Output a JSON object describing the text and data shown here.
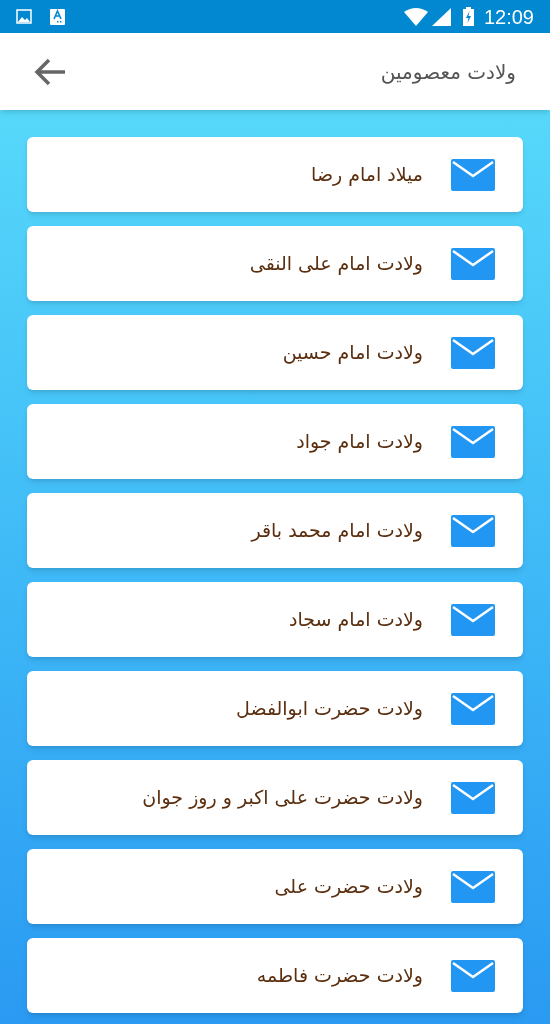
{
  "status_bar": {
    "time": "12:09"
  },
  "header": {
    "title": "ولادت معصومین"
  },
  "items": [
    {
      "label": "میلاد امام رضا"
    },
    {
      "label": "ولادت امام علی النقی"
    },
    {
      "label": "ولادت امام حسین"
    },
    {
      "label": "ولادت امام جواد"
    },
    {
      "label": "ولادت امام محمد باقر"
    },
    {
      "label": "ولادت امام سجاد"
    },
    {
      "label": "ولادت حضرت ابوالفضل"
    },
    {
      "label": "ولادت حضرت علی اکبر و روز جوان"
    },
    {
      "label": "ولادت حضرت علی"
    },
    {
      "label": "ولادت حضرت فاطمه"
    }
  ]
}
